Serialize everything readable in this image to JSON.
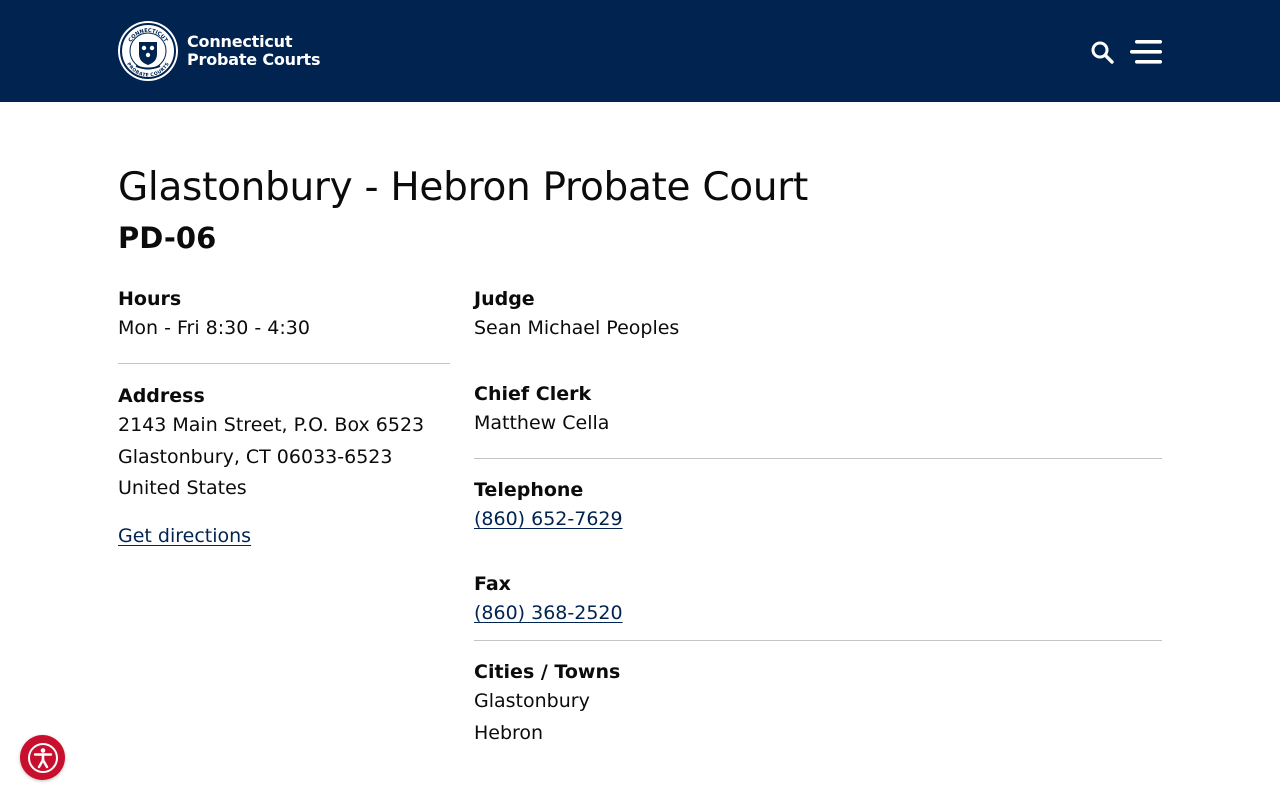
{
  "header": {
    "brand_line1": "Connecticut",
    "brand_line2": "Probate Courts",
    "seal_top_text": "CONNECTICUT",
    "seal_bottom_text": "PROBATE COURTS",
    "background_color": "#002350",
    "search_icon": "search-icon",
    "menu_icon": "hamburger-menu-icon"
  },
  "court": {
    "title": "Glastonbury - Hebron Probate Court",
    "code": "PD-06"
  },
  "hours": {
    "label": "Hours",
    "value": "Mon - Fri 8:30 - 4:30"
  },
  "address": {
    "label": "Address",
    "line1": "2143 Main Street, P.O. Box 6523",
    "line2": "Glastonbury, CT 06033-6523",
    "line3": "United States",
    "directions_label": "Get directions"
  },
  "judge": {
    "label": "Judge",
    "value": "Sean Michael Peoples"
  },
  "chief_clerk": {
    "label": "Chief Clerk",
    "value": "Matthew Cella"
  },
  "telephone": {
    "label": "Telephone",
    "value": "(860) 652-7629"
  },
  "fax": {
    "label": "Fax",
    "value": "(860) 368-2520"
  },
  "towns": {
    "label": "Cities / Towns",
    "items": [
      "Glastonbury",
      "Hebron"
    ]
  },
  "accessibility": {
    "icon": "accessibility-icon",
    "color": "#c8102e"
  },
  "colors": {
    "link": "#002350",
    "divider": "#c4c4c4",
    "text": "#0b0b0b"
  }
}
